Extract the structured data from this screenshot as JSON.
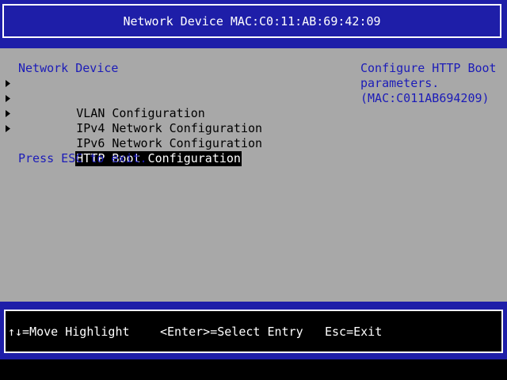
{
  "header": {
    "title": "Network Device MAC:C0:11:AB:69:42:09"
  },
  "menu": {
    "heading": "Network Device",
    "items": [
      {
        "label": "VLAN Configuration"
      },
      {
        "label": "IPv4 Network Configuration"
      },
      {
        "label": "IPv6 Network Configuration"
      },
      {
        "label": "HTTP Boot Configuration",
        "selected": true
      }
    ],
    "exit_hint": "Press ESC to exit."
  },
  "help": {
    "lines": [
      "Configure HTTP Boot",
      "parameters.",
      "(MAC:C011AB694209)"
    ]
  },
  "footer": {
    "move": "↑↓=Move Highlight",
    "select": "<Enter>=Select Entry",
    "exit": "Esc=Exit"
  },
  "colors": {
    "background_grey": "#a8a8a8",
    "bar_blue": "#1e1ea8",
    "text_blue": "#1c1cb8",
    "highlight_bg": "#000000",
    "highlight_fg": "#ffffff"
  },
  "icons": {
    "submenu_marker": "triangle-right-icon"
  }
}
